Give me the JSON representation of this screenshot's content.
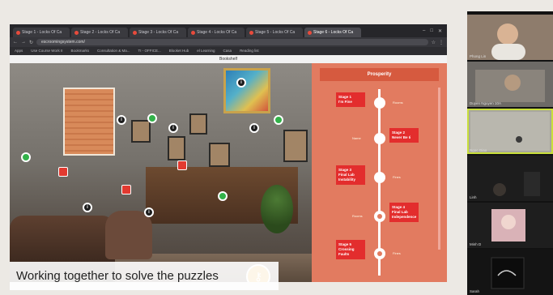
{
  "browser": {
    "tabs": [
      "Stage 1 - Locks Of Ca",
      "Stage 2 - Locks Of Ca",
      "Stage 3 - Locks Of Ca",
      "Stage 4 - Locks Of Ca",
      "Stage 5 - Locks Of Ca",
      "Stage 6 - Locks Of Ca"
    ],
    "url": "escroomingsystem.com/",
    "bookmarks": [
      "Apps",
      "Use Course Work II",
      "Bookmarks",
      "Consultation & Ma...",
      "TI - OFFICE...",
      "Blooket Hub",
      "el Learning",
      "Casa",
      "Reading list"
    ]
  },
  "page": {
    "header": "Bookshelf",
    "panel_title": "Prosperity",
    "steps": [
      {
        "label": "Stage 1\nI'm Fine",
        "side": "left",
        "date": "Rooms"
      },
      {
        "label": "Stage 2\nNever Be Ii",
        "side": "right",
        "date": "Name"
      },
      {
        "label": "Stage 3\nFinal Lab\nInstability",
        "side": "left",
        "date": "Fines"
      },
      {
        "label": "Stage 4\nFinal Lab\nIndependence",
        "side": "right",
        "date": "Rooms"
      },
      {
        "label": "Stage 5\nCrossing\nFaults",
        "side": "left",
        "date": "Fines"
      }
    ]
  },
  "caption": "Working together to solve the puzzles",
  "gallery": [
    {
      "name": "Phong Lin",
      "bg": "#8e7c6c",
      "active": false
    },
    {
      "name": "Duyen Nguyen 10A",
      "bg": "#6d6a66",
      "active": false
    },
    {
      "name": "Ngoc Giao",
      "bg": "#a9a79e",
      "active": true
    },
    {
      "name": "Linh",
      "bg": "#1d1d1d",
      "active": false
    },
    {
      "name": "Minh D",
      "bg": "#1e1e1e",
      "active": false
    },
    {
      "name": "Sarah",
      "bg": "#141414",
      "active": false
    }
  ],
  "colors": {
    "accent": "#e27b60",
    "step_red": "#e32d2d",
    "hotspot_green": "#33b24a",
    "key_gold": "#e6a623",
    "active_border": "#c9df3b"
  }
}
